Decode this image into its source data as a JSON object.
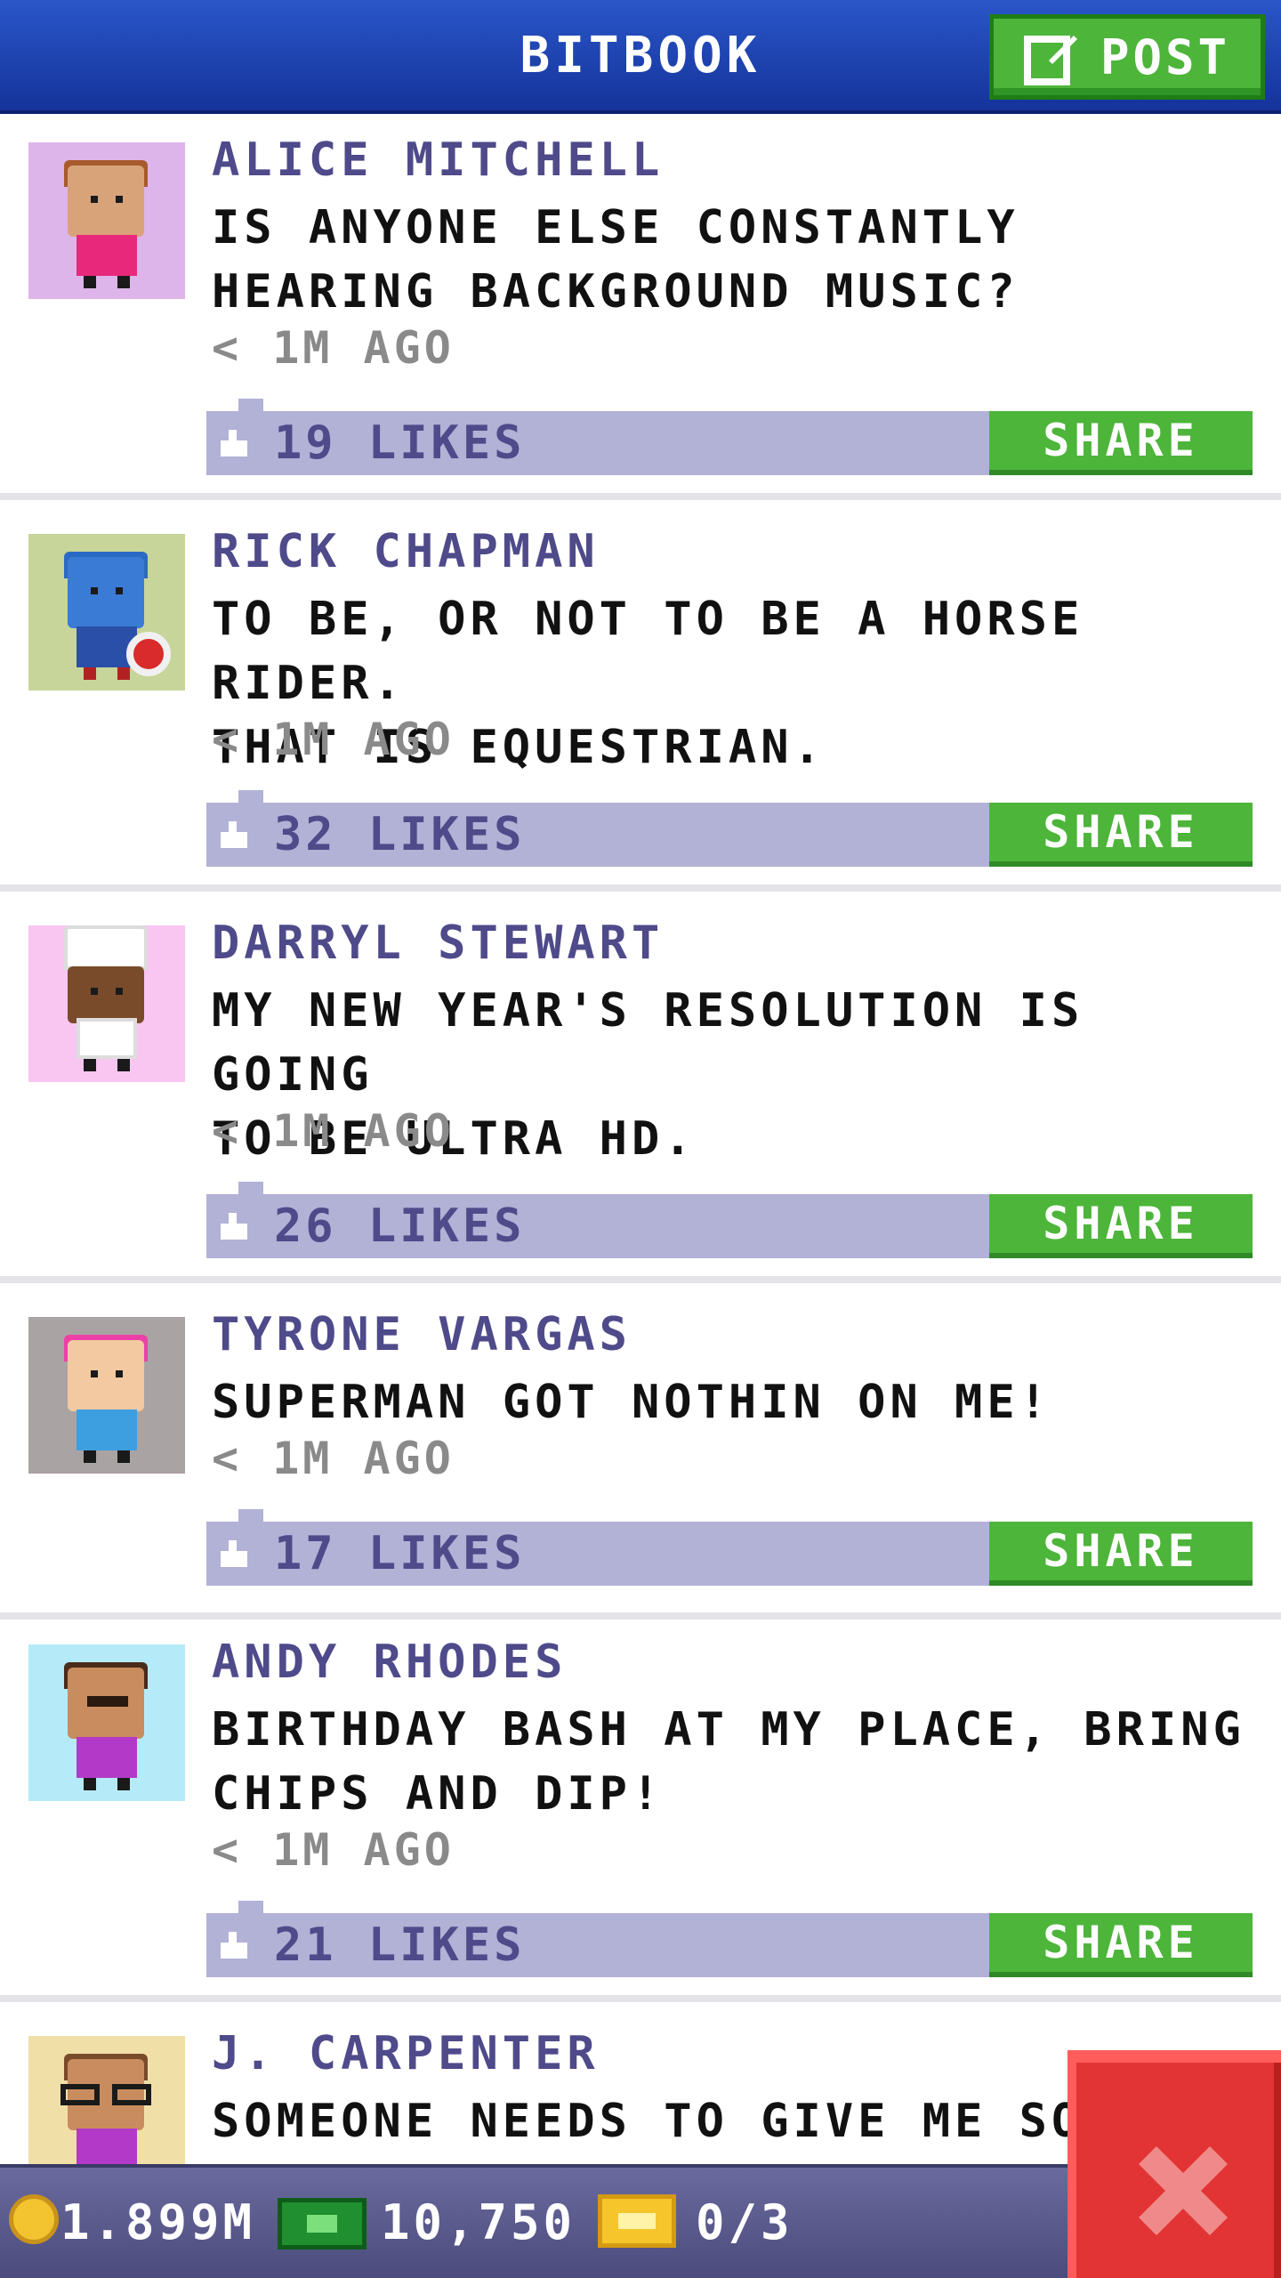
{
  "header": {
    "title": "BITBOOK",
    "post_label": "POST"
  },
  "posts": [
    {
      "name": "ALICE MITCHELL",
      "message": "IS ANYONE ELSE CONSTANTLY\nHEARING BACKGROUND MUSIC?",
      "time": "< 1M AGO",
      "likes": "19 LIKES",
      "share_label": "SHARE"
    },
    {
      "name": "RICK CHAPMAN",
      "message": "TO BE, OR NOT TO BE A HORSE RIDER.\nTHAT IS EQUESTRIAN.",
      "time": "< 1M AGO",
      "likes": "32 LIKES",
      "share_label": "SHARE"
    },
    {
      "name": "DARRYL STEWART",
      "message": "MY NEW YEAR'S RESOLUTION IS GOING\nTO BE ULTRA HD.",
      "time": "< 1M AGO",
      "likes": "26 LIKES",
      "share_label": "SHARE"
    },
    {
      "name": "TYRONE VARGAS",
      "message": "SUPERMAN GOT NOTHIN ON ME!",
      "time": "< 1M AGO",
      "likes": "17 LIKES",
      "share_label": "SHARE"
    },
    {
      "name": "ANDY RHODES",
      "message": "BIRTHDAY BASH AT MY PLACE, BRING\nCHIPS AND DIP!",
      "time": "< 1M AGO",
      "likes": "21 LIKES",
      "share_label": "SHARE"
    },
    {
      "name": "J. CARPENTER",
      "message": "SOMEONE NEEDS TO GIVE ME SO"
    }
  ],
  "stats": {
    "coins": "1.899M",
    "cash": "10,750",
    "tickets": "0/3"
  },
  "colors": {
    "header": "#1f45b3",
    "accent_green": "#4db53a",
    "like_bar": "#b2b1d6",
    "name_text": "#4f4a8a",
    "close_red": "#e23434"
  },
  "icons": [
    "post-edit-icon",
    "thumbs-up-icon",
    "coin-icon",
    "cash-icon",
    "ticket-icon",
    "close-icon"
  ]
}
